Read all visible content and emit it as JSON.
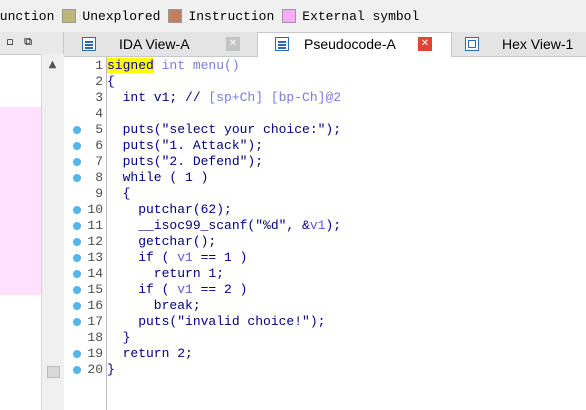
{
  "legend": [
    {
      "label": "function",
      "color": "#ffffff"
    },
    {
      "label": "Unexplored",
      "color": "#bdb77b"
    },
    {
      "label": "Instruction",
      "color": "#c08060"
    },
    {
      "label": "External symbol",
      "color": "#ffa8ff"
    }
  ],
  "left_pane": {
    "restore_glyph": "▫",
    "float_glyph": "⧉"
  },
  "tabs": [
    {
      "label": "IDA View-A",
      "close": "✕",
      "icon": "ida-view-icon"
    },
    {
      "label": "Pseudocode-A",
      "close": "✕",
      "icon": "pseudocode-icon"
    },
    {
      "label": "Hex View-1",
      "icon": "hex-view-icon"
    }
  ],
  "code_lines": [
    {
      "num": "1",
      "bp": false,
      "segments": [
        {
          "t": "signed",
          "c": "kw-hl"
        },
        {
          "t": " int menu()",
          "c": "cmt"
        }
      ]
    },
    {
      "num": "2",
      "bp": false,
      "segments": [
        {
          "t": "{",
          "c": ""
        }
      ]
    },
    {
      "num": "3",
      "bp": false,
      "segments": [
        {
          "t": "  int v1; // ",
          "c": ""
        },
        {
          "t": "[sp+Ch] [bp-Ch]@2",
          "c": "cmt"
        }
      ]
    },
    {
      "num": "4",
      "bp": false,
      "segments": []
    },
    {
      "num": "5",
      "bp": true,
      "segments": [
        {
          "t": "  puts(\"select your choice:\");",
          "c": ""
        }
      ]
    },
    {
      "num": "6",
      "bp": true,
      "segments": [
        {
          "t": "  puts(\"1. Attack\");",
          "c": ""
        }
      ]
    },
    {
      "num": "7",
      "bp": true,
      "segments": [
        {
          "t": "  puts(\"2. Defend\");",
          "c": ""
        }
      ]
    },
    {
      "num": "8",
      "bp": true,
      "segments": [
        {
          "t": "  while ( 1 )",
          "c": ""
        }
      ]
    },
    {
      "num": "9",
      "bp": false,
      "segments": [
        {
          "t": "  {",
          "c": ""
        }
      ]
    },
    {
      "num": "10",
      "bp": true,
      "segments": [
        {
          "t": "    putchar(62);",
          "c": ""
        }
      ]
    },
    {
      "num": "11",
      "bp": true,
      "segments": [
        {
          "t": "    __isoc99_scanf(\"%d\", &",
          "c": ""
        },
        {
          "t": "v1",
          "c": "var"
        },
        {
          "t": ");",
          "c": ""
        }
      ]
    },
    {
      "num": "12",
      "bp": true,
      "segments": [
        {
          "t": "    getchar();",
          "c": ""
        }
      ]
    },
    {
      "num": "13",
      "bp": true,
      "segments": [
        {
          "t": "    if ( ",
          "c": ""
        },
        {
          "t": "v1",
          "c": "var"
        },
        {
          "t": " == 1 )",
          "c": ""
        }
      ]
    },
    {
      "num": "14",
      "bp": true,
      "segments": [
        {
          "t": "      return 1;",
          "c": ""
        }
      ]
    },
    {
      "num": "15",
      "bp": true,
      "segments": [
        {
          "t": "    if ( ",
          "c": ""
        },
        {
          "t": "v1",
          "c": "var"
        },
        {
          "t": " == 2 )",
          "c": ""
        }
      ]
    },
    {
      "num": "16",
      "bp": true,
      "segments": [
        {
          "t": "      break;",
          "c": ""
        }
      ]
    },
    {
      "num": "17",
      "bp": true,
      "segments": [
        {
          "t": "    puts(\"invalid choice!\");",
          "c": ""
        }
      ]
    },
    {
      "num": "18",
      "bp": false,
      "segments": [
        {
          "t": "  }",
          "c": ""
        }
      ]
    },
    {
      "num": "19",
      "bp": true,
      "segments": [
        {
          "t": "  return 2;",
          "c": ""
        }
      ]
    },
    {
      "num": "20",
      "bp": true,
      "segments": [
        {
          "t": "}",
          "c": ""
        }
      ]
    }
  ],
  "colors": {
    "breakpoint": "#53b6ec",
    "keyword_highlight": "#ffff00",
    "tab_close_active": "#e2452f",
    "external_symbol": "#ffe0ff"
  }
}
